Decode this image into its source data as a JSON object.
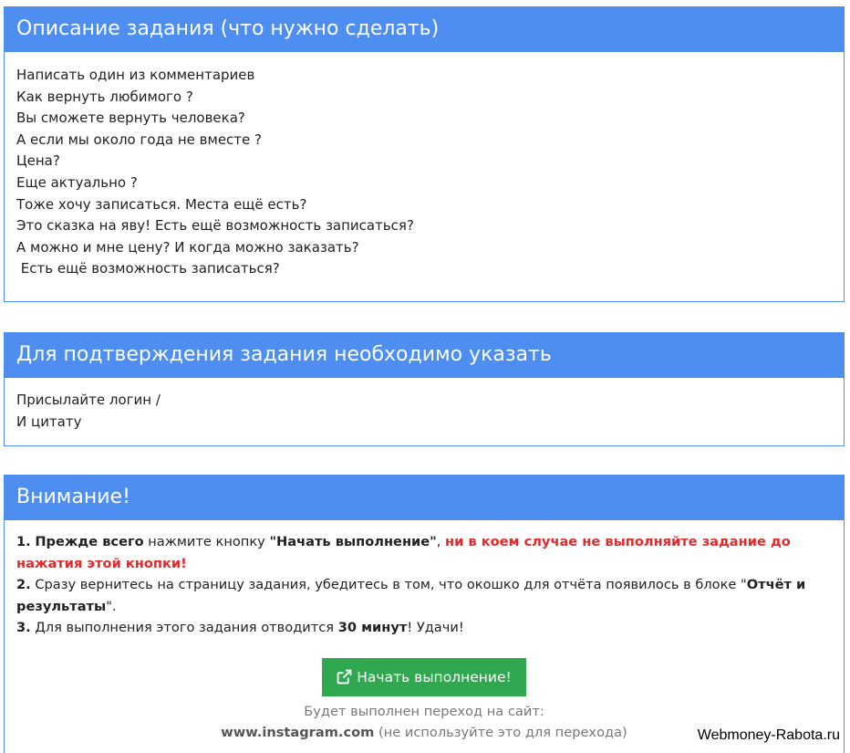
{
  "description": {
    "title": "Описание задания (что нужно сделать)",
    "lines": [
      "Написать один из комментариев",
      "Как вернуть любимого ?",
      "Вы сможете вернуть человека?",
      "А если мы около года не вместе ?",
      "Цена?",
      "Еще актуально ?",
      "Тоже хочу записаться. Места ещё есть?",
      "Это сказка на яву! Есть ещё возможность записаться?",
      "А можно и мне цену? И когда можно заказать?",
      " Есть ещё возможность записаться?"
    ]
  },
  "confirmation": {
    "title": "Для подтверждения задания необходимо указать",
    "lines": [
      "Присылайте логин /",
      "И цитату"
    ]
  },
  "attention": {
    "title": "Внимание!",
    "item1": {
      "num": "1.",
      "bold_start": "Прежде всего",
      "text1": " нажмите кнопку ",
      "quoted": "\"Начать выполнение\"",
      "comma": ", ",
      "warning": "ни в коем случае не выполняйте задание до нажатия этой кнопки!"
    },
    "item2": {
      "num": "2.",
      "text1": " Сразу вернитесь на страницу задания, убедитесь в том, что окошко для отчёта появилось в блоке \"",
      "bold": "Отчёт и результаты",
      "text2": "\"."
    },
    "item3": {
      "num": "3.",
      "text1": " Для выполнения этого задания отводится ",
      "bold": "30 минут",
      "text2": "! Удачи!"
    },
    "start_button": "Начать выполнение!",
    "redirect_label": "Будет выполнен переход на сайт:",
    "site": "www.instagram.com",
    "site_note": " (не используйте это для перехода)"
  },
  "watermark": "Webmoney-Rabota.ru",
  "colors": {
    "panel_header": "#4d8ef0",
    "button": "#2fa84f",
    "warning": "#e02b2b"
  }
}
